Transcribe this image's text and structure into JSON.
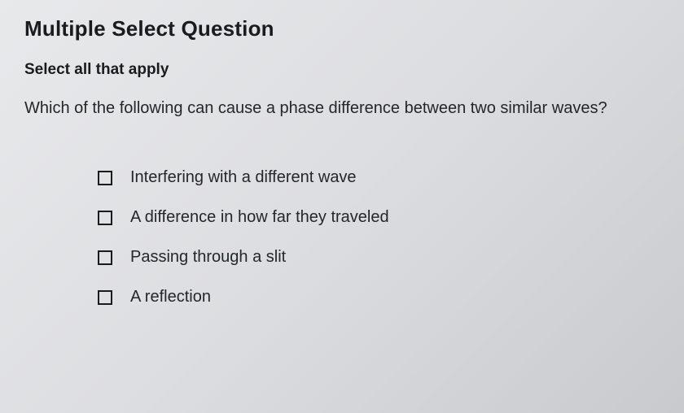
{
  "question": {
    "type_label": "Multiple Select Question",
    "instruction": "Select all that apply",
    "prompt": "Which of the following can cause a phase difference between two similar waves?",
    "options": [
      {
        "label": "Interfering with a different wave"
      },
      {
        "label": "A difference in how far they traveled"
      },
      {
        "label": "Passing through a slit"
      },
      {
        "label": "A reflection"
      }
    ]
  }
}
